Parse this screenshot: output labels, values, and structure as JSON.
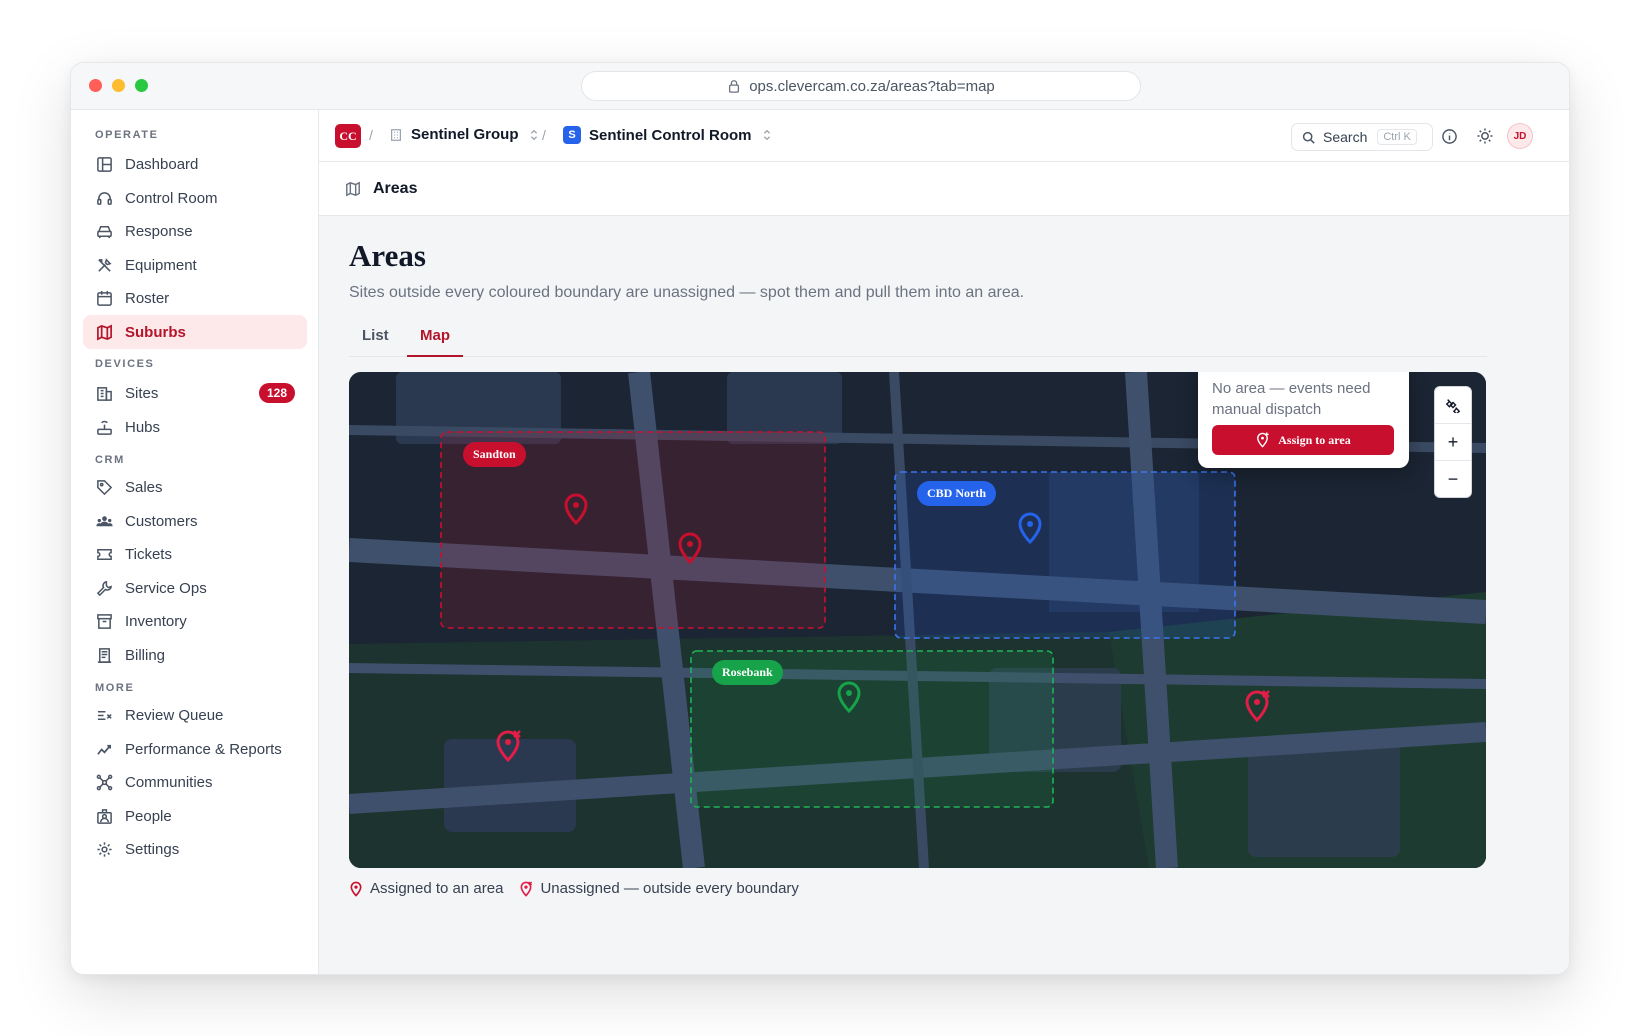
{
  "browser": {
    "url": "ops.clevercam.co.za/areas?tab=map"
  },
  "sidebar": {
    "sections": [
      {
        "label": "OPERATE"
      },
      {
        "label": "DEVICES"
      },
      {
        "label": "CRM"
      },
      {
        "label": "MORE"
      }
    ],
    "items": [
      {
        "label": "Dashboard",
        "icon": "dashboard-icon"
      },
      {
        "label": "Control Room",
        "icon": "headset-icon"
      },
      {
        "label": "Response",
        "icon": "car-icon"
      },
      {
        "label": "Equipment",
        "icon": "tools-icon"
      },
      {
        "label": "Roster",
        "icon": "calendar-icon"
      },
      {
        "label": "Suburbs",
        "icon": "map-icon",
        "active": true
      },
      {
        "label": "Sites",
        "icon": "building-icon",
        "badge": "128"
      },
      {
        "label": "Hubs",
        "icon": "hub-icon"
      },
      {
        "label": "Sales",
        "icon": "tag-icon"
      },
      {
        "label": "Customers",
        "icon": "users-icon"
      },
      {
        "label": "Tickets",
        "icon": "ticket-icon"
      },
      {
        "label": "Service Ops",
        "icon": "wrench-icon"
      },
      {
        "label": "Inventory",
        "icon": "archive-icon"
      },
      {
        "label": "Billing",
        "icon": "receipt-icon"
      },
      {
        "label": "Review Queue",
        "icon": "list-check-icon"
      },
      {
        "label": "Performance & Reports",
        "icon": "trend-icon"
      },
      {
        "label": "Communities",
        "icon": "network-icon"
      },
      {
        "label": "People",
        "icon": "people-icon"
      },
      {
        "label": "Settings",
        "icon": "gear-icon"
      }
    ]
  },
  "topbar": {
    "org_initials": "CC",
    "org_name": "Sentinel Group",
    "room_initial": "S",
    "room_name": "Sentinel Control Room",
    "search_label": "Search",
    "search_shortcut": "Ctrl K",
    "avatar_initials": "JD"
  },
  "pagebar": {
    "title": "Areas"
  },
  "page": {
    "title": "Areas",
    "subtitle": "Sites outside every coloured boundary are unassigned — spot them and pull them into an area.",
    "tabs": [
      {
        "label": "List"
      },
      {
        "label": "Map",
        "active": true
      }
    ]
  },
  "map": {
    "areas": [
      {
        "name": "Sandton",
        "color": "#c8102e"
      },
      {
        "name": "CBD North",
        "color": "#2563eb"
      },
      {
        "name": "Rosebank",
        "color": "#16a34a"
      }
    ],
    "popup": {
      "text": "No area — events need manual dispatch",
      "button_label": "Assign to area"
    },
    "controls": {
      "zoom_in": "+",
      "zoom_out": "−"
    }
  },
  "legend": {
    "assigned": "Assigned to an area",
    "unassigned": "Unassigned — outside every boundary"
  },
  "colors": {
    "brand": "#c8102e",
    "active_bg": "#fde8ea",
    "map_bg": "#1b2533"
  }
}
